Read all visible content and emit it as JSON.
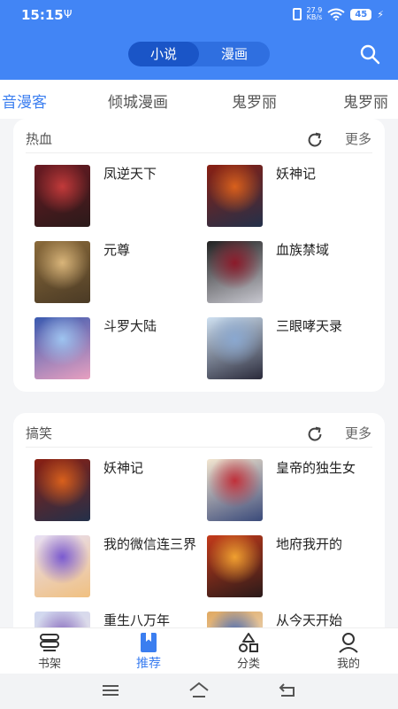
{
  "statusbar": {
    "time": "15:15",
    "usb_icon": "usb-icon",
    "net_speed_value": "27.9",
    "net_speed_unit": "KB/s",
    "battery": "45"
  },
  "header": {
    "toggle": [
      {
        "label": "小说",
        "active": true
      },
      {
        "label": "漫画",
        "active": false
      }
    ],
    "search_icon": "search-icon"
  },
  "tabs": [
    "音漫客",
    "倾城漫画",
    "鬼罗丽",
    "鬼罗丽"
  ],
  "sections": [
    {
      "title": "热血",
      "more": "更多",
      "items": [
        {
          "title": "凤逆天下",
          "colors": [
            "#6b1a22",
            "#c23a3a",
            "#2a1a1a"
          ]
        },
        {
          "title": "妖神记",
          "colors": [
            "#8a1f12",
            "#d9601c",
            "#23304a"
          ]
        },
        {
          "title": "元尊",
          "colors": [
            "#8a6a3a",
            "#d9b57a",
            "#4a3a25"
          ]
        },
        {
          "title": "血族禁域",
          "colors": [
            "#222",
            "#8c1a2a",
            "#c8c8d0"
          ]
        },
        {
          "title": "斗罗大陆",
          "colors": [
            "#3a5ab0",
            "#9ec4f0",
            "#e8a0c0"
          ]
        },
        {
          "title": "三眼哮天录",
          "colors": [
            "#cfe1f2",
            "#8aa8d0",
            "#2a2a3a"
          ]
        }
      ]
    },
    {
      "title": "搞笑",
      "more": "更多",
      "items": [
        {
          "title": "妖神记",
          "colors": [
            "#8a1f12",
            "#d9601c",
            "#23304a"
          ]
        },
        {
          "title": "皇帝的独生女",
          "colors": [
            "#f3e6d0",
            "#c0303a",
            "#3a4a7a"
          ]
        },
        {
          "title": "我的微信连三界",
          "colors": [
            "#e8e0f5",
            "#7a5ad0",
            "#f0c080"
          ]
        },
        {
          "title": "地府我开的",
          "colors": [
            "#c43a1a",
            "#f0a030",
            "#2a1a1a"
          ]
        },
        {
          "title": "重生八万年",
          "colors": [
            "#d0d8f0",
            "#8a70c0",
            "#f0e0e0"
          ]
        },
        {
          "title": "从今天开始",
          "colors": [
            "#e0a860",
            "#4a6ab0",
            "#f0f0f0"
          ]
        }
      ]
    }
  ],
  "bottom_nav": [
    {
      "label": "书架",
      "icon": "bookshelf-icon",
      "active": false
    },
    {
      "label": "推荐",
      "icon": "bookmark-icon",
      "active": true
    },
    {
      "label": "分类",
      "icon": "category-icon",
      "active": false
    },
    {
      "label": "我的",
      "icon": "user-icon",
      "active": false
    }
  ],
  "system_nav": [
    "menu-icon",
    "home-icon",
    "back-icon"
  ],
  "colors": {
    "brand": "#4285f5",
    "accent": "#3b7ef0"
  }
}
